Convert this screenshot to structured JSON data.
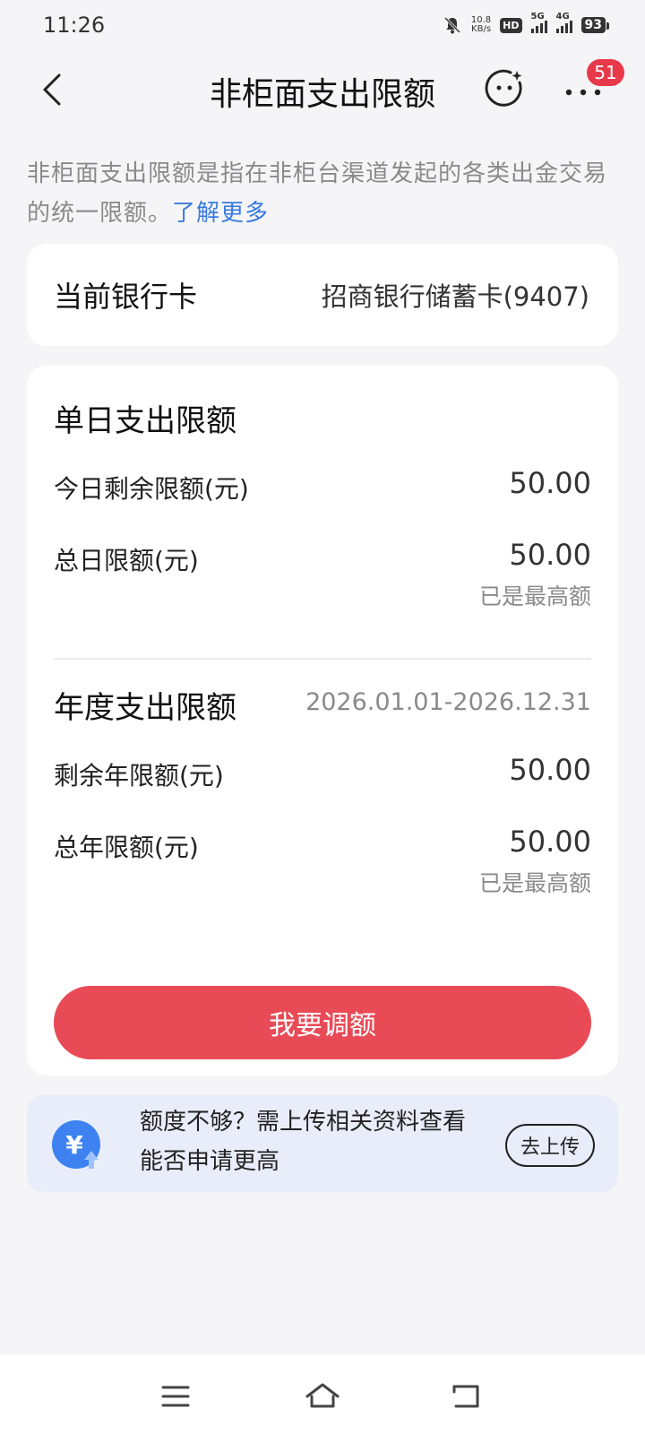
{
  "status_bar": {
    "time": "11:26",
    "net_speed_value": "10.8",
    "net_speed_unit": "KB/s",
    "hd_label": "HD",
    "sim1_label": "5G",
    "sim2_label": "4G",
    "battery": "93"
  },
  "header": {
    "title": "非柜面支出限额",
    "badge_count": "51"
  },
  "intro": {
    "text": "非柜面支出限额是指在非柜台渠道发起的各类出金交易的统一限额。",
    "link": "了解更多"
  },
  "bank_card": {
    "label": "当前银行卡",
    "value": "招商银行储蓄卡(9407)"
  },
  "daily": {
    "title": "单日支出限额",
    "remaining_label": "今日剩余限额(元)",
    "remaining_value": "50.00",
    "total_label": "总日限额(元)",
    "total_value": "50.00",
    "total_note": "已是最高额"
  },
  "yearly": {
    "title": "年度支出限额",
    "date_range": "2026.01.01-2026.12.31",
    "remaining_label": "剩余年限额(元)",
    "remaining_value": "50.00",
    "total_label": "总年限额(元)",
    "total_value": "50.00",
    "total_note": "已是最高额"
  },
  "adjust_button": "我要调额",
  "upload_banner": {
    "text": "额度不够？需上传相关资料查看能否申请更高",
    "button": "去上传",
    "icon_symbol": "¥"
  },
  "colors": {
    "accent_red": "#e84a56",
    "link_blue": "#3a7be0",
    "badge_red": "#e8394a",
    "banner_bg": "#e9edfa",
    "icon_blue": "#3d82f0"
  },
  "icons": {
    "back": "chevron-left-icon",
    "service": "smiley-service-icon",
    "more": "more-dots-icon",
    "upload": "yuan-upload-icon",
    "nav_menu": "menu-icon",
    "nav_home": "home-icon",
    "nav_back": "back-arrow-icon"
  }
}
